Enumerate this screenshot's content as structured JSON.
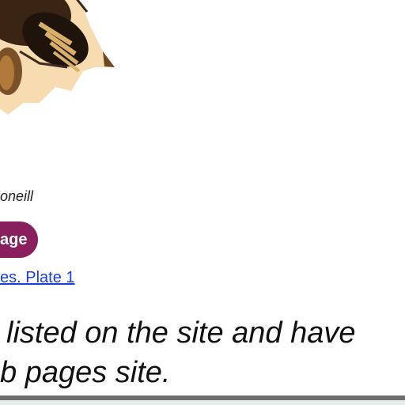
{
  "header": {
    "image_name": "beetle-illustration"
  },
  "attribution": {
    "username": "oneill"
  },
  "actions": {
    "image_button_label": "age"
  },
  "source": {
    "link_text": "es. Plate 1"
  },
  "notice": {
    "line1": "listed on the site and have",
    "line2": "b pages site."
  },
  "colors": {
    "button_bg": "#8a1f5e",
    "link": "#1a3fd8",
    "bottom_bar": "#6d6d6d"
  }
}
